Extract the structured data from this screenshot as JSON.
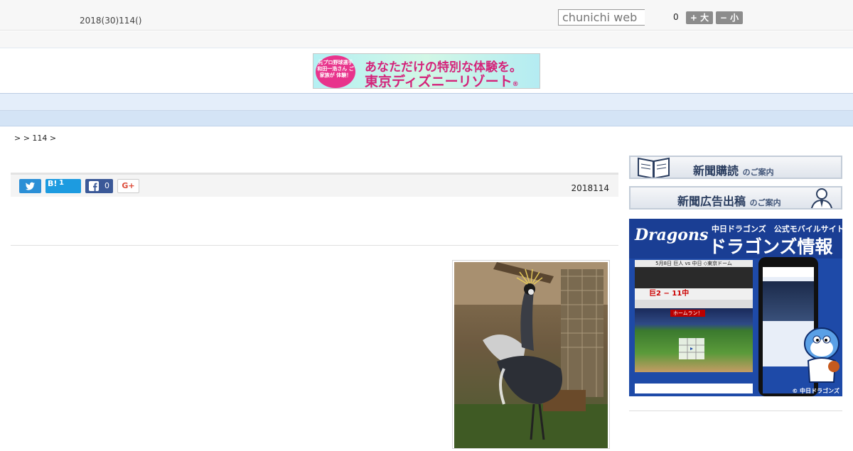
{
  "header": {
    "date_text": "2018(30)114()",
    "search_placeholder": "chunichi web",
    "counter": "0",
    "font_large_label": "+ 大",
    "font_small_label": "− 小"
  },
  "banner_ad": {
    "badge_text": "元プロ野球選手 和田一浩さん ご家族が 体験！",
    "line1": "あなただけの特別な体験を。",
    "line2": "東京ディズニーリゾート",
    "mark": "®"
  },
  "nav": {
    "items": [
      "",
      "",
      "",
      "",
      "",
      "",
      "",
      "",
      ""
    ]
  },
  "breadcrumb": {
    "text": ">  > 114 >"
  },
  "share": {
    "hatena_label": "B!",
    "hatena_count": "1",
    "facebook_count": "0",
    "gplus_label": "G+"
  },
  "article": {
    "date": "2018114"
  },
  "sidebar": {
    "subscribe_main": "新聞購読",
    "subscribe_sub": "のご案内",
    "advertise_main": "新聞広告出稿",
    "advertise_sub": "のご案内",
    "dragons_logo": "Dragons",
    "dragons_top": "中日ドラゴンズ　公式モバイルサイト",
    "dragons_title": "ドラゴンズ情報",
    "dragons_game": "5月8日 巨人 vs 中日 ◇東京ドーム",
    "dragons_score": "巨2 − 11中",
    "dragons_homerun": "ホームラン！",
    "dragons_copyright": "© 中日ドラゴンズ"
  },
  "colors": {
    "nav_bg": "#e4eefa",
    "twitter": "#2b8fd6",
    "hatena": "#1d9be0",
    "facebook": "#3b5998",
    "dragons_blue": "#1e4aa8"
  }
}
